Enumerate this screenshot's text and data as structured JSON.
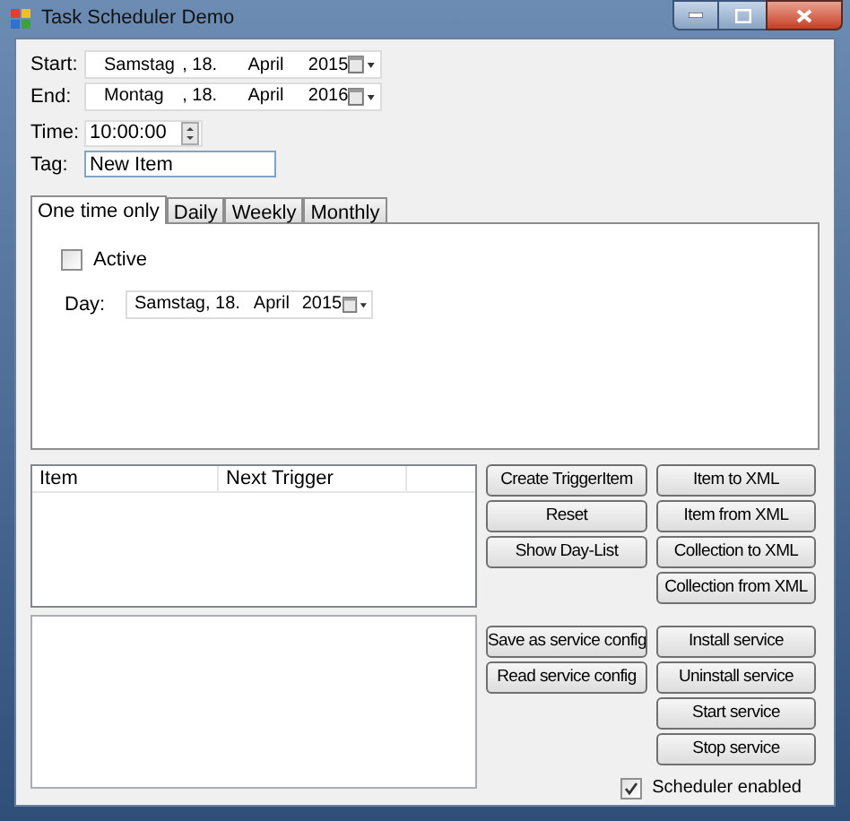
{
  "window": {
    "title": "Task Scheduler Demo"
  },
  "fields": [
    {
      "kind": "date",
      "label": "Start:",
      "weekday": "Samstag",
      "day": ", 18.",
      "month": "April",
      "year": "2015"
    },
    {
      "kind": "date",
      "label": "End:",
      "weekday": "Montag",
      "day": ", 18.",
      "month": "April",
      "year": "2016"
    },
    {
      "kind": "time",
      "label": "Time:",
      "value": "10:00:00"
    },
    {
      "kind": "text",
      "label": "Tag:",
      "value": "New Item"
    }
  ],
  "tabs": [
    {
      "label": "One time only",
      "selected": true
    },
    {
      "label": "Daily",
      "selected": false
    },
    {
      "label": "Weekly",
      "selected": false
    },
    {
      "label": "Monthly",
      "selected": false
    }
  ],
  "tab_panel": {
    "active": {
      "label": "Active",
      "checked": false
    },
    "day": {
      "kind": "date",
      "label": "Day:",
      "weekday": "Samstag",
      "day": ", 18.",
      "month": "April",
      "year": "2015"
    }
  },
  "list": {
    "columns": [
      "Item",
      "Next Trigger"
    ]
  },
  "item_buttons": {
    "left": [
      "Create TriggerItem",
      "Reset",
      "Show Day-List"
    ],
    "right": [
      "Item to XML",
      "Item from XML",
      "Collection to XML",
      "Collection from XML"
    ]
  },
  "service_buttons": {
    "left": [
      "Save as service config",
      "Read service config"
    ],
    "right": [
      "Install service",
      "Uninstall service",
      "Start service",
      "Stop service"
    ]
  },
  "scheduler_enabled": {
    "label": "Scheduler enabled",
    "checked": true
  }
}
